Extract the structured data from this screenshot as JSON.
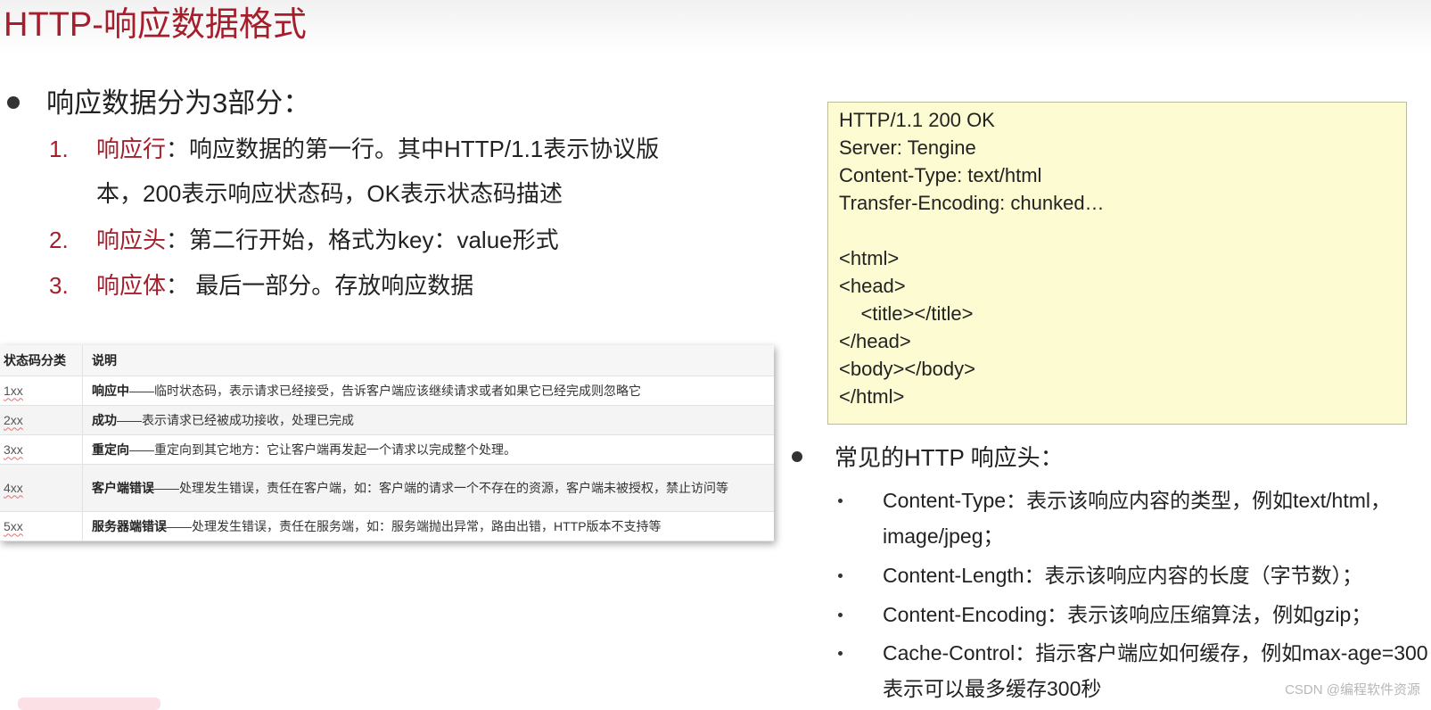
{
  "title": "HTTP-响应数据格式",
  "intro": "响应数据分为3部分：",
  "parts": [
    {
      "num": "1.",
      "key": "响应行",
      "text": "：响应数据的第一行。其中HTTP/1.1表示协议版",
      "cont": "本，200表示响应状态码，OK表示状态码描述"
    },
    {
      "num": "2.",
      "key": "响应头",
      "text": "：第二行开始，格式为key：value形式"
    },
    {
      "num": "3.",
      "key": "响应体",
      "text": "： 最后一部分。存放响应数据"
    }
  ],
  "status_table": {
    "headers": [
      "状态码分类",
      "说明"
    ],
    "rows": [
      {
        "code": "1xx",
        "title": "响应中",
        "desc": "——临时状态码，表示请求已经接受，告诉客户端应该继续请求或者如果它已经完成则忽略它"
      },
      {
        "code": "2xx",
        "title": "成功",
        "desc": "——表示请求已经被成功接收，处理已完成"
      },
      {
        "code": "3xx",
        "title": "重定向",
        "desc": "——重定向到其它地方：它让客户端再发起一个请求以完成整个处理。"
      },
      {
        "code": "4xx",
        "title": "客户端错误",
        "desc": "——处理发生错误，责任在客户端，如：客户端的请求一个不存在的资源，客户端未被授权，禁止访问等"
      },
      {
        "code": "5xx",
        "title": "服务器端错误",
        "desc": "——处理发生错误，责任在服务端，如：服务端抛出异常，路由出错，HTTP版本不支持等"
      }
    ]
  },
  "code_lines": [
    "HTTP/1.1 200 OK",
    "Server: Tengine",
    "Content-Type: text/html",
    "Transfer-Encoding: chunked…",
    "",
    "<html>",
    "<head>",
    "    <title></title>",
    "</head>",
    "<body></body>",
    "</html>"
  ],
  "headers_title": "常见的HTTP 响应头：",
  "header_items": [
    {
      "l1": "Content-Type：表示该响应内容的类型，例如text/html，",
      "l2": "image/jpeg；"
    },
    {
      "l1": "Content-Length：表示该响应内容的长度（字节数）；"
    },
    {
      "l1": "Content-Encoding：表示该响应压缩算法，例如gzip；"
    },
    {
      "l1": "Cache-Control：指示客户端应如何缓存，例如max-age=300",
      "l2": "表示可以最多缓存300秒"
    }
  ],
  "watermark": "CSDN @编程软件资源"
}
